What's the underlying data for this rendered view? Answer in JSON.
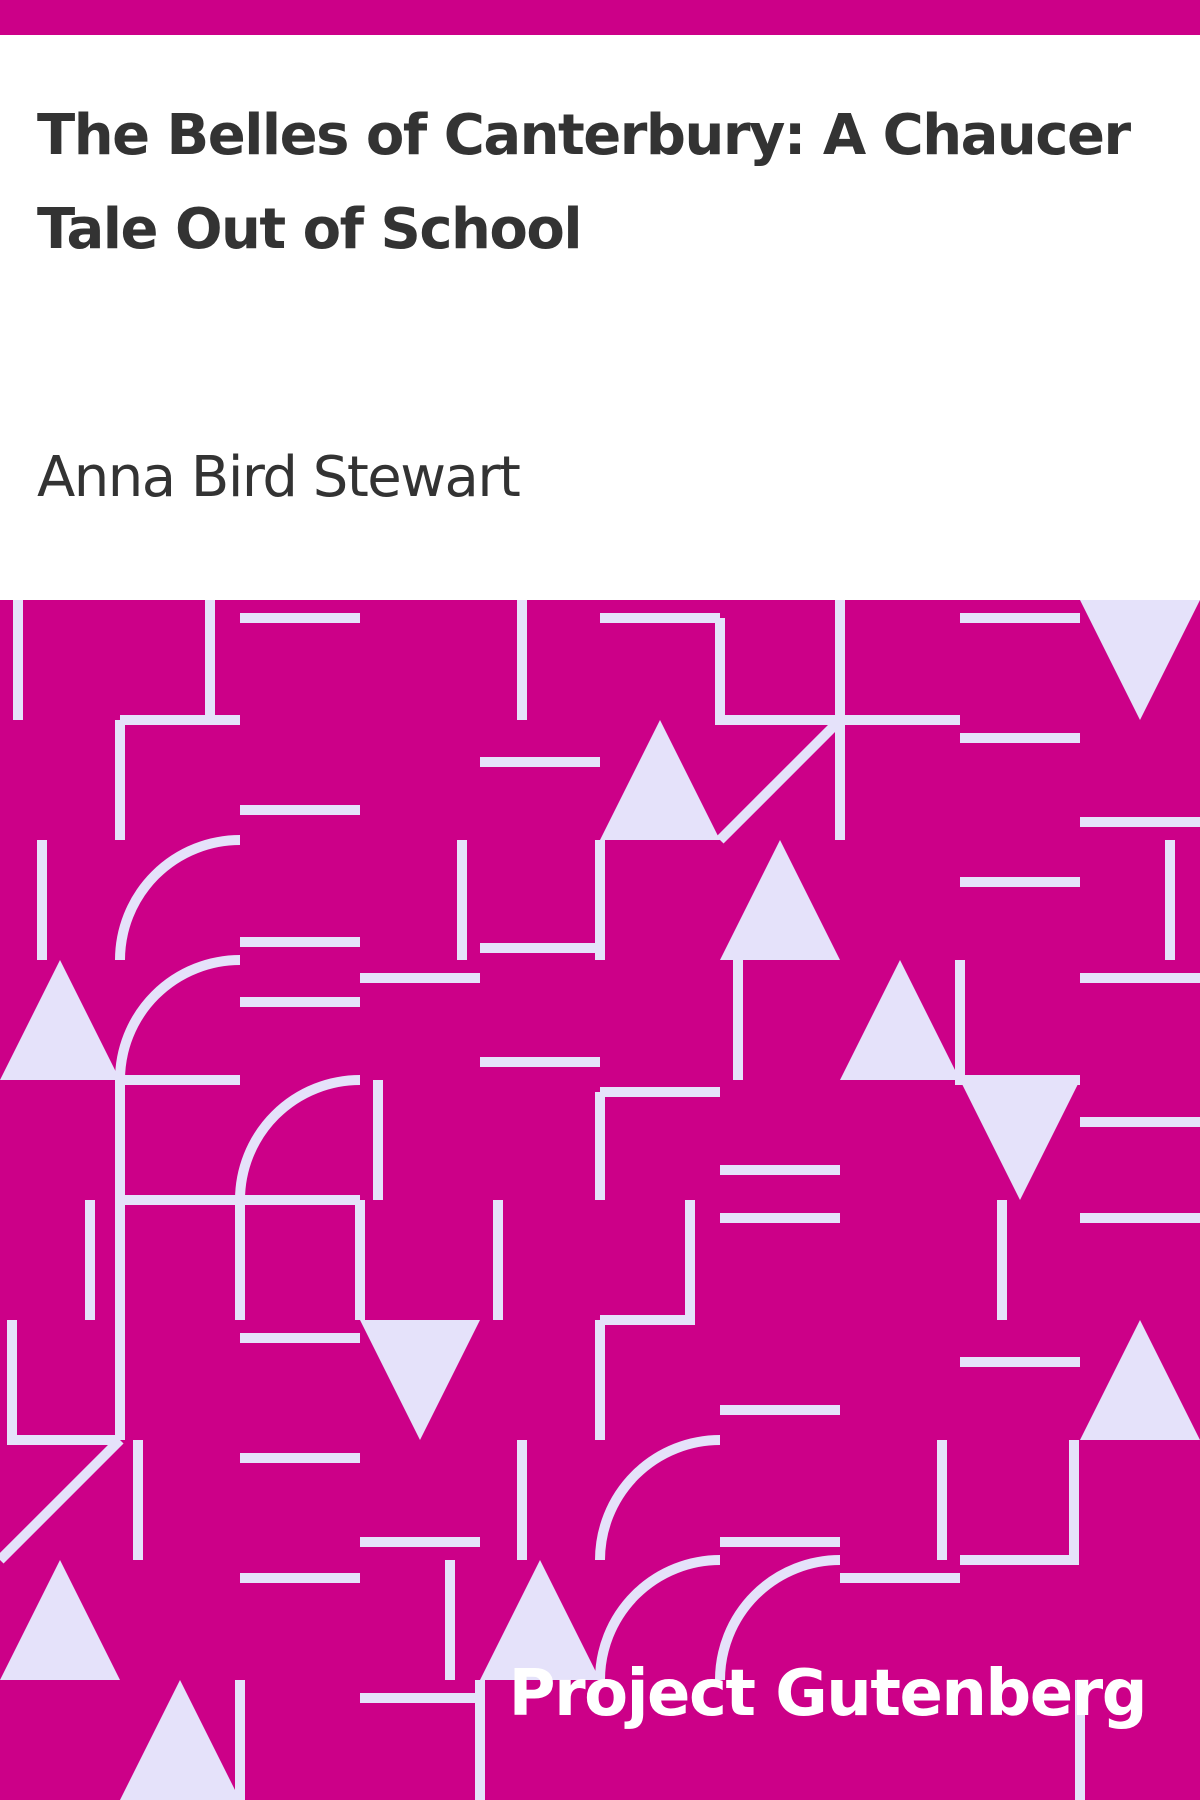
{
  "book": {
    "title": "The Belles of Canterbury: A Chaucer Tale Out of School",
    "author": "Anna Bird Stewart",
    "publisher": "Project Gutenberg"
  },
  "colors": {
    "accent": "#cc0088",
    "pattern_stroke": "#e5e2fa",
    "text": "#333333",
    "background": "#ffffff"
  }
}
